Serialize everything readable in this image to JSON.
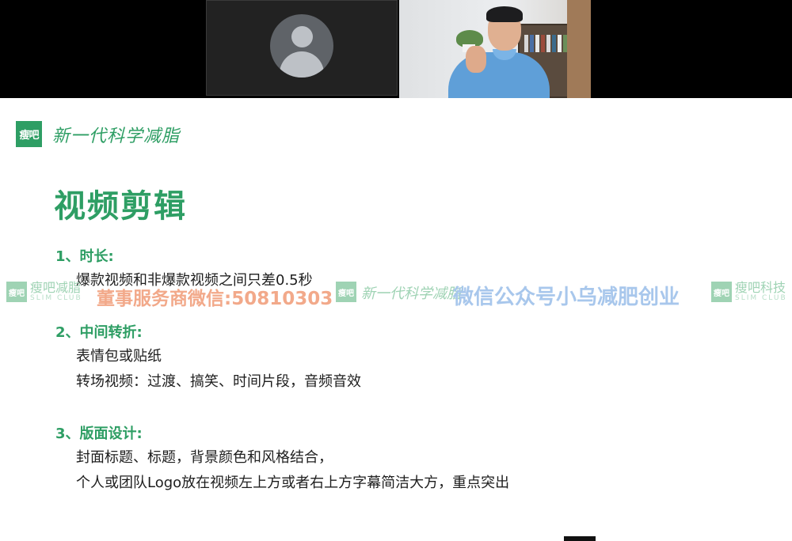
{
  "slide": {
    "logo_text": "瘦吧",
    "slogan": "新一代科学减脂",
    "title": "视频剪辑",
    "sections": [
      {
        "heading": "1、时长:",
        "lines": [
          "爆款视频和非爆款视频之间只差0.5秒"
        ]
      },
      {
        "heading": "2、中间转折:",
        "lines": [
          "表情包或贴纸",
          "转场视频：过渡、搞笑、时间片段，音频音效"
        ]
      },
      {
        "heading": "3、版面设计:",
        "lines": [
          "封面标题、标题，背景颜色和风格结合，",
          "个人或团队Logo放在视频左上方或者右上方字幕简洁大方，重点突出"
        ]
      }
    ]
  },
  "watermark": {
    "brand_cn_1": "瘦吧减脂",
    "brand_en": "SLIM CLUB",
    "contact": "董事服务商微信:50810303",
    "slogan": "新一代科学减脂",
    "wechat_account": "微信公众号小乌减肥创业",
    "brand_cn_2": "瘦吧科技",
    "logo_text": "瘦吧"
  },
  "colors": {
    "accent_green": "#2e9e64",
    "watermark_orange": "#f2a98a",
    "watermark_blue": "#a8c7ec"
  },
  "icons": {
    "participant_avatar": "person-silhouette-icon"
  }
}
